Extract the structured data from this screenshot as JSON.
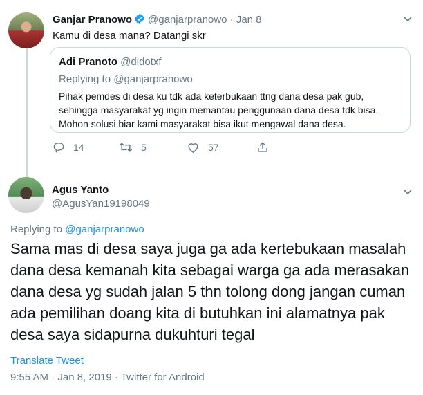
{
  "tweet1": {
    "display_name": "Ganjar Pranowo",
    "handle": "@ganjarpranowo",
    "date": "· Jan 8",
    "text": "Kamu di desa mana? Datangi skr",
    "quoted": {
      "display_name": "Adi Pranoto",
      "handle": "@didotxf",
      "replying_prefix": "Replying to ",
      "replying_to": "@ganjarpranowo",
      "body": "Pihak pemdes di desa ku tdk ada keterbukaan ttng dana desa pak gub, sehingga masyarakat yg ingin memantau penggunaan dana desa tdk bisa. Mohon solusi biar kami masyarakat bisa ikut mengawal dana desa."
    },
    "actions": {
      "replies": "14",
      "retweets": "5",
      "likes": "57"
    }
  },
  "tweet2": {
    "display_name": "Agus Yanto",
    "handle": "@AgusYan19198049",
    "replying_prefix": "Replying to ",
    "replying_to": "@ganjarpranowo",
    "body": "Sama mas di desa saya juga ga ada kertebukaan masalah dana desa kemanah kita sebagai warga ga ada merasakan dana desa yg sudah jalan 5 thn tolong dong jangan cuman ada pemilihan doang kita di butuhkan ini alamatnya pak desa saya sidapurna dukuhturi tegal",
    "translate_label": "Translate Tweet",
    "timestamp": "9:55 AM · Jan 8, 2019 · Twitter for Android"
  },
  "colors": {
    "link": "#1b95e0",
    "muted": "#657786",
    "text": "#14171a",
    "border": "#ccd6dd",
    "verified": "#1da1f2"
  },
  "icons": [
    "verified-icon",
    "chevron-down-icon",
    "reply-icon",
    "retweet-icon",
    "like-icon",
    "share-icon"
  ]
}
